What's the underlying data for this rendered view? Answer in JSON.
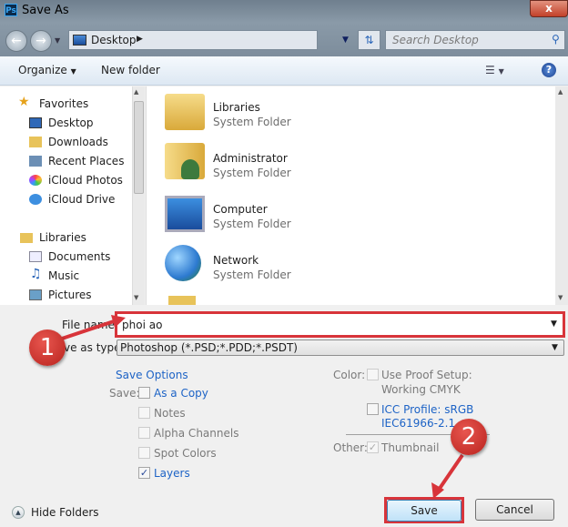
{
  "window": {
    "title": "Save As",
    "app_icon": "Ps",
    "close": "x"
  },
  "address": {
    "location": "Desktop",
    "search_placeholder": "Search Desktop"
  },
  "toolbar": {
    "organize": "Organize",
    "new_folder": "New folder"
  },
  "sidebar": {
    "items": [
      {
        "label": "Favorites",
        "icon": "star-icon",
        "group": true
      },
      {
        "label": "Desktop",
        "icon": "desktop-icon"
      },
      {
        "label": "Downloads",
        "icon": "downloads-icon"
      },
      {
        "label": "Recent Places",
        "icon": "recent-places-icon"
      },
      {
        "label": "iCloud Photos",
        "icon": "icloud-photos-icon"
      },
      {
        "label": "iCloud Drive",
        "icon": "icloud-drive-icon"
      },
      {
        "label": "Libraries",
        "icon": "libraries-icon",
        "group": true
      },
      {
        "label": "Documents",
        "icon": "documents-icon"
      },
      {
        "label": "Music",
        "icon": "music-icon"
      },
      {
        "label": "Pictures",
        "icon": "pictures-icon"
      }
    ]
  },
  "files": [
    {
      "name": "Libraries",
      "type": "System Folder"
    },
    {
      "name": "Administrator",
      "type": "System Folder"
    },
    {
      "name": "Computer",
      "type": "System Folder"
    },
    {
      "name": "Network",
      "type": "System Folder"
    }
  ],
  "form": {
    "file_name_label": "File name:",
    "file_name": "phoi ao",
    "save_type_label": "Save as type:",
    "save_type": "Photoshop (*.PSD;*.PDD;*.PSDT)",
    "save_options": "Save Options",
    "save_label": "Save:",
    "options": [
      {
        "label": "As a Copy",
        "checked": false,
        "enabled": true
      },
      {
        "label": "Notes",
        "checked": false,
        "enabled": false
      },
      {
        "label": "Alpha Channels",
        "checked": false,
        "enabled": false
      },
      {
        "label": "Spot Colors",
        "checked": false,
        "enabled": false
      },
      {
        "label": "Layers",
        "checked": true,
        "enabled": true
      }
    ],
    "color_label": "Color:",
    "proof_1": "Use Proof Setup:",
    "proof_2": "Working CMYK",
    "icc_1": "ICC Profile:  sRGB",
    "icc_2": "IEC61966-2.1",
    "other_label": "Other:",
    "thumbnail": "Thumbnail"
  },
  "footer": {
    "hide_folders": "Hide Folders",
    "save": "Save",
    "cancel": "Cancel"
  },
  "annotations": {
    "step1": "1",
    "step2": "2",
    "color": "#d8343a"
  }
}
